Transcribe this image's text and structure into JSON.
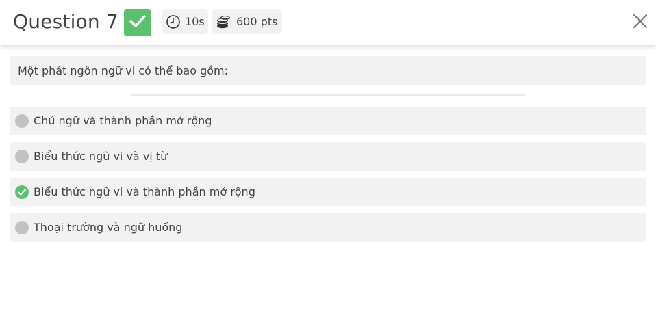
{
  "header": {
    "title": "Question 7",
    "status_icon": "checkmark-icon",
    "time_icon": "clock-icon",
    "time_label": "10s",
    "points_icon": "coins-icon",
    "points_label": "600 pts",
    "close_icon": "close-icon"
  },
  "question": {
    "text": "Một phát ngôn ngữ vi có thể bao gồm:"
  },
  "options": [
    {
      "label": "Chủ ngữ và thành phần mở rộng",
      "state": "unselected"
    },
    {
      "label": "Biểu thức ngữ vi và vị từ",
      "state": "unselected"
    },
    {
      "label": "Biểu thức ngữ vi và thành phần mở rộng",
      "state": "correct"
    },
    {
      "label": "Thoại trường và ngữ huống",
      "state": "unselected"
    }
  ],
  "colors": {
    "correct_green": "#5cc16f",
    "neutral_gray": "#c2c2c2",
    "panel_bg": "#f2f2f2",
    "text": "#444444"
  }
}
